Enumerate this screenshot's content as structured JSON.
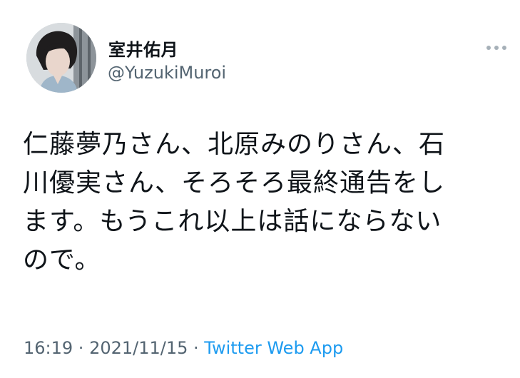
{
  "user": {
    "display_name": "室井佑月",
    "handle": "@YuzukiMuroi"
  },
  "tweet": {
    "text": "仁藤夢乃さん、北原みのりさん、石\n川優実さん、そろそろ最終通告をし\nます。もうこれ以上は話にならない\nので。"
  },
  "meta": {
    "time": "16:19",
    "separator": " · ",
    "date": "2021/11/15",
    "separator2": " · ",
    "source": "Twitter Web App"
  },
  "icons": {
    "more": "more-horizontal-icon"
  },
  "colors": {
    "secondary_text": "#536471",
    "link": "#1d9bf0"
  }
}
